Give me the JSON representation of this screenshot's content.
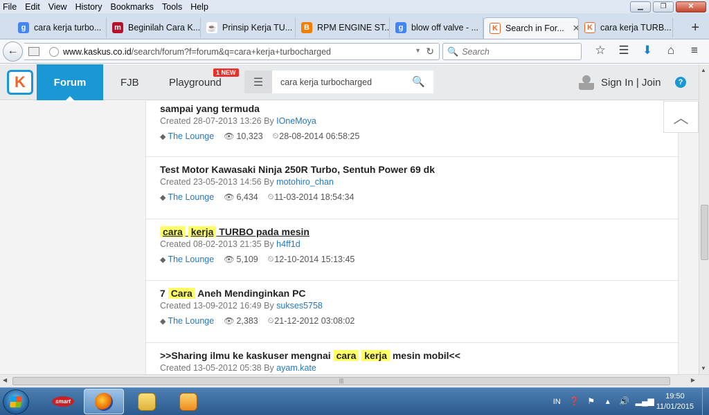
{
  "menu": [
    "File",
    "Edit",
    "View",
    "History",
    "Bookmarks",
    "Tools",
    "Help"
  ],
  "tabs": [
    {
      "label": "cara kerja turbo...",
      "icon": "google-icon",
      "color": "#4285f4",
      "glyph": "g"
    },
    {
      "label": "Beginilah Cara K...",
      "icon": "merdeka-icon",
      "color": "#b3122a",
      "glyph": "m"
    },
    {
      "label": "Prinsip Kerja TU...",
      "icon": "coffee-icon",
      "color": "#8b5a2b",
      "glyph": "☕"
    },
    {
      "label": "RPM ENGINE ST...",
      "icon": "blogger-icon",
      "color": "#f57d00",
      "glyph": "B"
    },
    {
      "label": "blow off valve - ...",
      "icon": "google-icon",
      "color": "#4285f4",
      "glyph": "g"
    },
    {
      "label": "Search in For...",
      "icon": "kaskus-icon",
      "color": "#f26522",
      "glyph": "K",
      "active": true
    },
    {
      "label": "cara kerja TURB...",
      "icon": "kaskus-icon",
      "color": "#f26522",
      "glyph": "K"
    }
  ],
  "nav": {
    "url_host": "www.kaskus.co.id",
    "url_path": "/search/forum?f=forum&q=cara+kerja+turbocharged",
    "search_placeholder": "Search"
  },
  "kaskus": {
    "nav_forum": "Forum",
    "nav_fjb": "FJB",
    "nav_playground": "Playground",
    "new_badge": "1 NEW",
    "search_value": "cara kerja turbocharged",
    "sign_in": "Sign In | Join"
  },
  "results": [
    {
      "title_line2": "sampai yang termuda",
      "created": "Created 28-07-2013 13:26 By ",
      "author": "IOneMoya",
      "category": "The Lounge",
      "views": "10,323",
      "last": "28-08-2014 06:58:25"
    },
    {
      "title": "Test Motor Kawasaki Ninja 250R Turbo, Sentuh Power 69 dk",
      "created": "Created 23-05-2013 14:56 By ",
      "author": "motohiro_chan",
      "category": "The Lounge",
      "views": "6,434",
      "last": "11-03-2014 18:54:34"
    },
    {
      "title_hl1": "cara",
      "title_hl2": "kerja",
      "title_rest": " TURBO pada mesin",
      "created": "Created 08-02-2013 21:35 By ",
      "author": "h4ff1d",
      "category": "The Lounge",
      "views": "5,109",
      "last": "12-10-2014 15:13:45"
    },
    {
      "title_pre": "7 ",
      "title_hl": "Cara",
      "title_rest": " Aneh Mendinginkan PC",
      "created": "Created 13-09-2012 16:49 By ",
      "author": "sukses5758",
      "category": "The Lounge",
      "views": "2,383",
      "last": "21-12-2012 03:08:02"
    },
    {
      "title_pre": ">>Sharing ilmu ke kaskuser mengnai ",
      "title_hl1": "cara",
      "title_hl2": "kerja",
      "title_rest": " mesin mobil<<",
      "created": "Created 13-05-2012 05:38 By ",
      "author": "ayam.kate"
    }
  ],
  "taskbar": {
    "smart_label": "smart",
    "lang": "IN",
    "time": "19:50",
    "date": "11/01/2015"
  }
}
